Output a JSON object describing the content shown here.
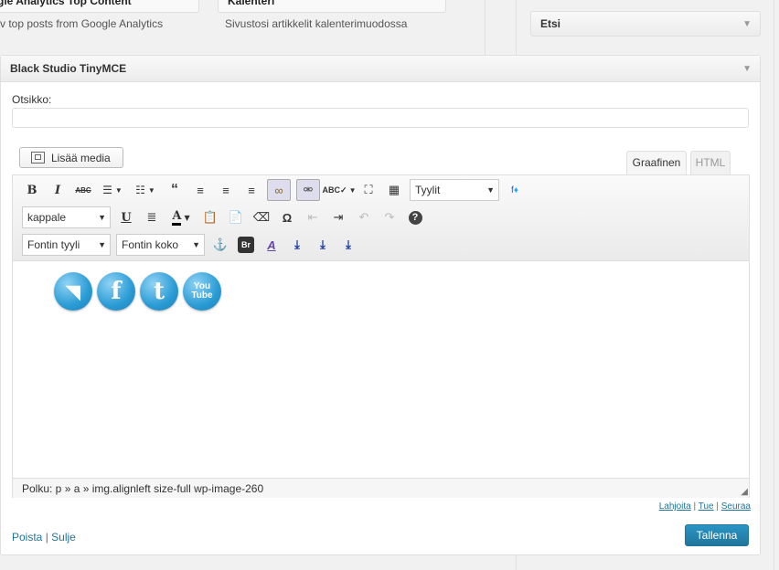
{
  "top_widgets": [
    {
      "title": "gle Analytics Top Content",
      "description": "v top posts from Google Analytics"
    },
    {
      "title": "Kalenteri",
      "description": "Sivustosi artikkelit kalenterimuodossa"
    }
  ],
  "sidebar": {
    "widget_title": "Etsi"
  },
  "panel": {
    "title": "Black Studio TinyMCE",
    "field_label": "Otsikko:",
    "field_value": "",
    "add_media_label": "Lisää media",
    "tabs": {
      "visual": "Graafinen",
      "html": "HTML"
    },
    "toolbar": {
      "styles_select": "Tyylit",
      "format_select": "kappale",
      "font_family_select": "Fontin tyyli",
      "font_size_select": "Fontin koko"
    },
    "social_icons": [
      "rss-icon",
      "facebook-icon",
      "twitter-icon",
      "youtube-icon"
    ],
    "youtube_text": "You Tube",
    "path": "Polku: p » a » img.alignleft size-full wp-image-260",
    "links": {
      "left": "Lahjoita",
      "middle": "Tue",
      "right": "Seuraa"
    },
    "actions": {
      "delete": "Poista",
      "close": "Sulje",
      "save": "Tallenna"
    }
  }
}
